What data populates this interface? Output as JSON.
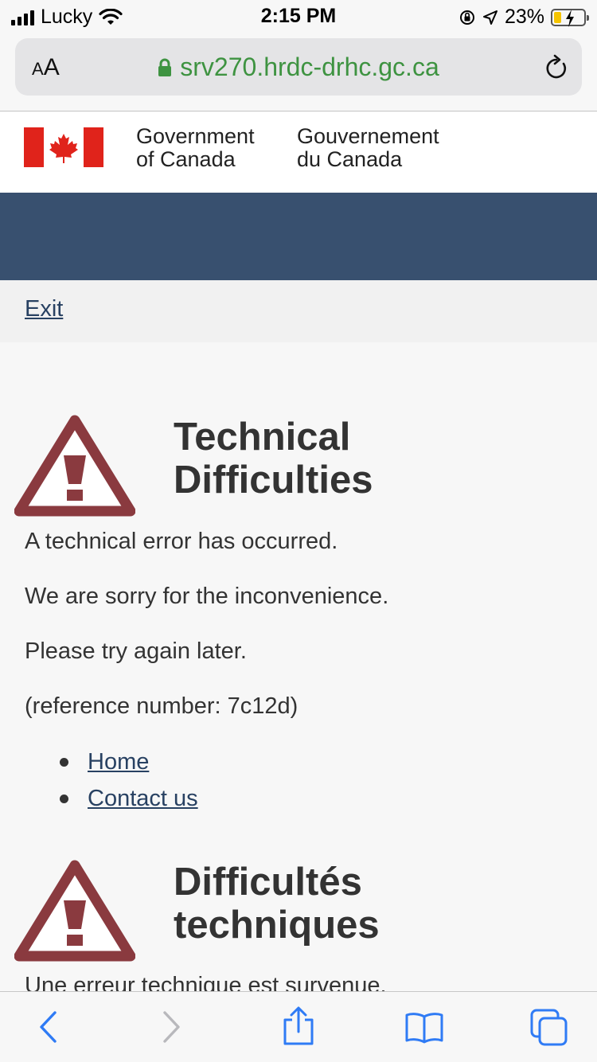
{
  "status_bar": {
    "carrier": "Lucky",
    "time": "2:15 PM",
    "battery_percent": "23%",
    "icons": [
      "signal-icon",
      "wifi-icon",
      "orientation-lock-icon",
      "location-icon",
      "battery-charging-icon"
    ]
  },
  "browser": {
    "text_size_label_small": "A",
    "text_size_label_large": "A",
    "url": "srv270.hrdc-drhc.gc.ca",
    "secure": true
  },
  "header": {
    "gov_en_line1": "Government",
    "gov_en_line2": "of Canada",
    "gov_fr_line1": "Gouvernement",
    "gov_fr_line2": "du Canada"
  },
  "nav": {
    "exit_label": "Exit"
  },
  "english": {
    "heading_line1": "Technical",
    "heading_line2": "Difficulties",
    "p1": "A technical error has occurred.",
    "p2": "We are sorry for the inconvenience.",
    "p3": "Please try again later.",
    "p4": "(reference number: 7c12d)",
    "links": [
      "Home",
      "Contact us"
    ]
  },
  "french": {
    "heading_line1": "Difficultés",
    "heading_line2": "techniques",
    "p1": "Une erreur technique est survenue."
  },
  "colors": {
    "accent_blue": "#38506f",
    "link": "#284162",
    "warning": "#8a3a3f",
    "url_green": "#3e9341",
    "ios_blue": "#2f7bf5"
  }
}
